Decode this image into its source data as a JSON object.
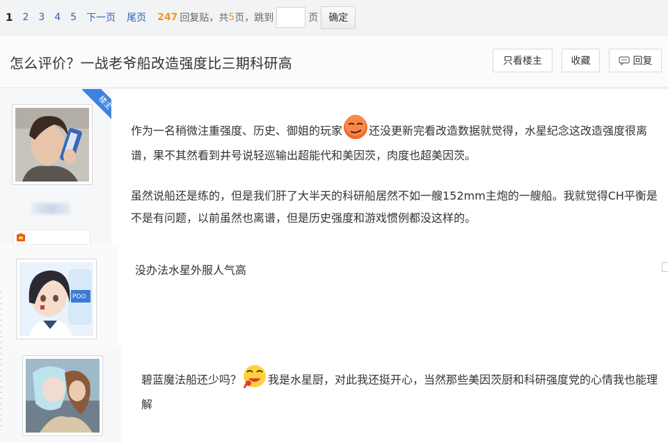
{
  "pager": {
    "current": "1",
    "pages": [
      "2",
      "3",
      "4",
      "5"
    ],
    "next": "下一页",
    "last": "尾页",
    "reply_count": "247",
    "reply_label": "回复贴，共",
    "page_count": "5",
    "page_unit": "页",
    "jump_label": "，跳到",
    "jump_value": "",
    "jump_unit": "页",
    "confirm": "确定"
  },
  "thread": {
    "title": "怎么评价？一战老爷船改造强度比三期科研高",
    "only_op": "只看楼主",
    "favorite": "收藏",
    "reply": "回复"
  },
  "posts": [
    {
      "badge": "楼主",
      "para1_a": "作为一名稍微注重强度、历史、御姐的玩家",
      "para1_b": "还没更新完看改造数据就觉得，水星纪念这改造强度很离谱，果不其然看到井号说轻巡输出超能代和美因茨，肉度也超美因茨。",
      "para2": "虽然说船还是练的，但是我们肝了大半天的科研船居然不如一艘152mm主炮的一艘船。我就觉得CH平衡是不是有问题，以前虽然也离谱，但是历史强度和游戏惯例都没这样的。"
    },
    {
      "text": "没办法水星外服人气高"
    },
    {
      "text_a": "碧蓝魔法船还少吗？",
      "text_b": "我是水星厨，对此我还挺开心，当然那些美因茨厨和科研强度党的心情我也能理解"
    }
  ],
  "colors": {
    "link": "#2d64b3",
    "count": "#f7941d",
    "badge": "#3e82e0"
  }
}
